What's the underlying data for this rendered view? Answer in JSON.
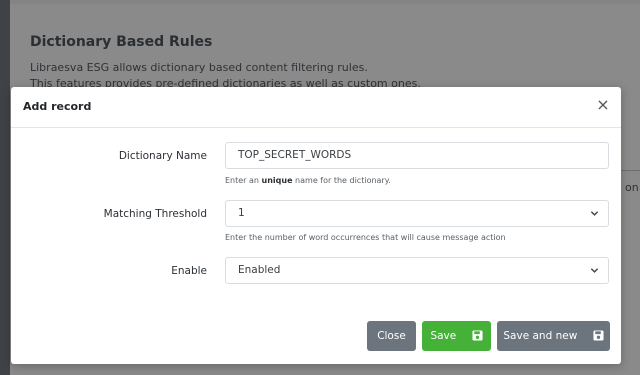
{
  "background": {
    "title": "Dictionary Based Rules",
    "desc_line1": "Libraesva ESG allows dictionary based content filtering rules.",
    "desc_line2": "This features provides pre-defined dictionaries as well as custom ones.",
    "right_fragment": "on"
  },
  "modal": {
    "title": "Add record",
    "close_symbol": "×",
    "fields": {
      "dictionary_name": {
        "label": "Dictionary Name",
        "value": "TOP_SECRET_WORDS",
        "help_prefix": "Enter an ",
        "help_bold": "unique",
        "help_suffix": " name for the dictionary."
      },
      "matching_threshold": {
        "label": "Matching Threshold",
        "value": "1",
        "help": "Enter the number of word occurrences that will cause message action"
      },
      "enable": {
        "label": "Enable",
        "value": "Enabled"
      }
    },
    "buttons": {
      "close": "Close",
      "save": "Save",
      "save_and_new": "Save and new"
    }
  },
  "colors": {
    "save": "#45b139",
    "secondary": "#6c757d",
    "overlay": "#848484"
  },
  "icons": {
    "close": "close-icon",
    "save": "floppy-disk-icon",
    "select": "chevron-down-icon"
  }
}
